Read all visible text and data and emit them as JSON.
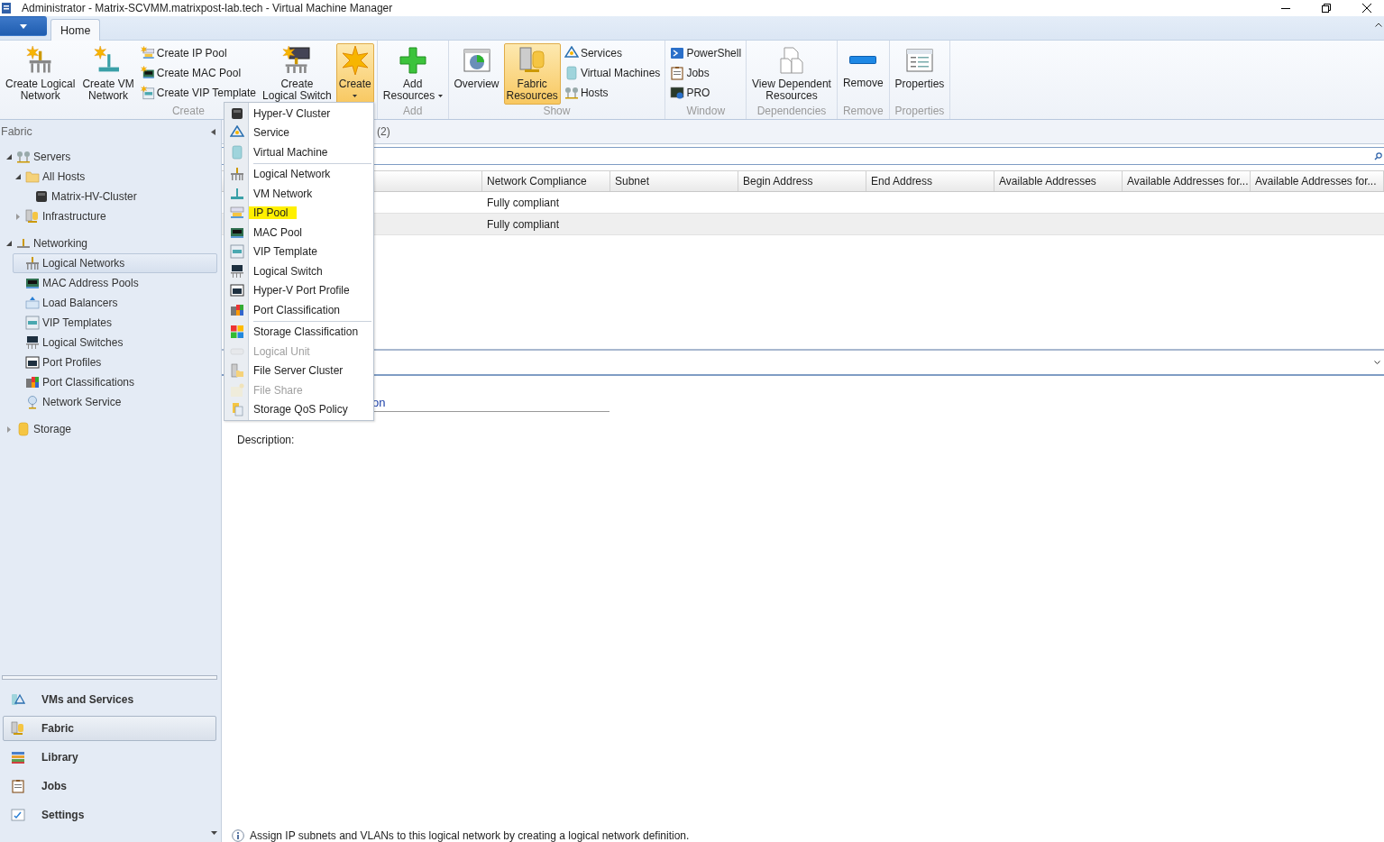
{
  "window": {
    "title": "Administrator - Matrix-SCVMM.matrixpost-lab.tech - Virtual Machine Manager"
  },
  "tabs": [
    {
      "label": "Home",
      "selected": true
    }
  ],
  "ribbon": {
    "groups": [
      {
        "label": "Create",
        "items": [
          {
            "kind": "large",
            "label": "Create Logical\nNetwork",
            "highlighted": false
          },
          {
            "kind": "large",
            "label": "Create VM\nNetwork",
            "highlighted": false
          },
          {
            "kind": "stack",
            "items": [
              {
                "label": "Create IP Pool"
              },
              {
                "label": "Create MAC Pool"
              },
              {
                "label": "Create VIP Template"
              }
            ]
          },
          {
            "kind": "large",
            "label": "Create\nLogical Switch",
            "highlighted": false
          },
          {
            "kind": "dropdown",
            "label": "Create",
            "highlighted": true
          }
        ]
      },
      {
        "label": "Add",
        "items": [
          {
            "kind": "dropdown",
            "label": "Add\nResources",
            "highlighted": false
          }
        ]
      },
      {
        "label": "Show",
        "items": [
          {
            "kind": "large",
            "label": "Overview",
            "highlighted": false
          },
          {
            "kind": "large",
            "label": "Fabric\nResources",
            "highlighted": true
          },
          {
            "kind": "stack",
            "items": [
              {
                "label": "Services"
              },
              {
                "label": "Virtual Machines"
              },
              {
                "label": "Hosts"
              }
            ]
          }
        ]
      },
      {
        "label": "Window",
        "items": [
          {
            "kind": "stack",
            "items": [
              {
                "label": "PowerShell"
              },
              {
                "label": "Jobs"
              },
              {
                "label": "PRO"
              }
            ]
          }
        ]
      },
      {
        "label": "Dependencies",
        "items": [
          {
            "kind": "large",
            "label": "View Dependent\nResources",
            "highlighted": false
          }
        ]
      },
      {
        "label": "Remove",
        "items": [
          {
            "kind": "large",
            "label": "Remove",
            "highlighted": false
          }
        ]
      },
      {
        "label": "Properties",
        "items": [
          {
            "kind": "large",
            "label": "Properties",
            "highlighted": false
          }
        ]
      }
    ]
  },
  "navigation": {
    "title": "Fabric",
    "tree": [
      {
        "label": "Servers",
        "expanded": true,
        "selected": false,
        "children": [
          {
            "label": "All Hosts",
            "expanded": true,
            "selected": false,
            "children": [
              {
                "label": "Matrix-HV-Cluster",
                "selected": false
              }
            ]
          },
          {
            "label": "Infrastructure",
            "expanded": false,
            "selected": false
          }
        ]
      },
      {
        "label": "Networking",
        "expanded": true,
        "selected": false,
        "children": [
          {
            "label": "Logical Networks",
            "selected": true
          },
          {
            "label": "MAC Address Pools",
            "selected": false
          },
          {
            "label": "Load Balancers",
            "selected": false
          },
          {
            "label": "VIP Templates",
            "selected": false
          },
          {
            "label": "Logical Switches",
            "selected": false
          },
          {
            "label": "Port Profiles",
            "selected": false
          },
          {
            "label": "Port Classifications",
            "selected": false
          },
          {
            "label": "Network Service",
            "selected": false
          }
        ]
      },
      {
        "label": "Storage",
        "expanded": false,
        "selected": false
      }
    ],
    "workspaces": [
      {
        "label": "VMs and Services",
        "selected": false
      },
      {
        "label": "Fabric",
        "selected": true
      },
      {
        "label": "Library",
        "selected": false
      },
      {
        "label": "Jobs",
        "selected": false
      },
      {
        "label": "Settings",
        "selected": false
      }
    ]
  },
  "list": {
    "count": "(2)",
    "columns": [
      "Network Compliance",
      "Subnet",
      "Begin Address",
      "End Address",
      "Available Addresses",
      "Available Addresses for...",
      "Available Addresses for..."
    ],
    "rows": [
      {
        "cells": [
          "Fully compliant"
        ]
      },
      {
        "cells": [
          "Fully compliant"
        ]
      }
    ]
  },
  "details": {
    "section_link": "on",
    "description_label": "Description:",
    "info_message": "Assign IP subnets and VLANs to this logical network by creating a logical network definition."
  },
  "create_menu": {
    "sections": [
      {
        "items": [
          {
            "label": "Hyper-V Cluster",
            "disabled": false,
            "highlighted": false
          },
          {
            "label": "Service",
            "disabled": false,
            "highlighted": false
          },
          {
            "label": "Virtual Machine",
            "disabled": false,
            "highlighted": false
          }
        ]
      },
      {
        "items": [
          {
            "label": "Logical Network",
            "disabled": false,
            "highlighted": false
          },
          {
            "label": "VM Network",
            "disabled": false,
            "highlighted": false
          },
          {
            "label": "IP Pool",
            "disabled": false,
            "highlighted": true
          },
          {
            "label": "MAC Pool",
            "disabled": false,
            "highlighted": false
          },
          {
            "label": "VIP Template",
            "disabled": false,
            "highlighted": false
          },
          {
            "label": "Logical Switch",
            "disabled": false,
            "highlighted": false
          },
          {
            "label": "Hyper-V Port Profile",
            "disabled": false,
            "highlighted": false
          },
          {
            "label": "Port Classification",
            "disabled": false,
            "highlighted": false
          }
        ]
      },
      {
        "items": [
          {
            "label": "Storage Classification",
            "disabled": false,
            "highlighted": false
          },
          {
            "label": "Logical Unit",
            "disabled": true,
            "highlighted": false
          },
          {
            "label": "File Server Cluster",
            "disabled": false,
            "highlighted": false
          },
          {
            "label": "File Share",
            "disabled": true,
            "highlighted": false
          },
          {
            "label": "Storage QoS Policy",
            "disabled": false,
            "highlighted": false
          }
        ]
      }
    ]
  }
}
